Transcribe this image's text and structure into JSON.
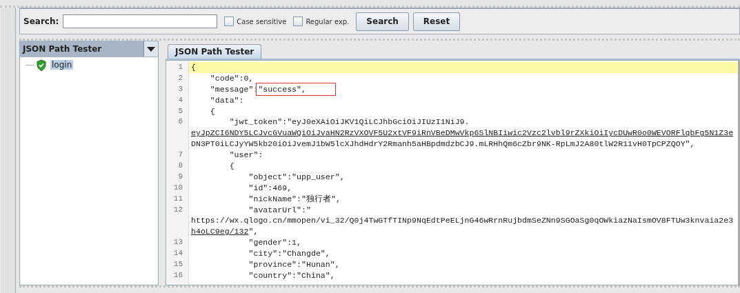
{
  "search_bar": {
    "label": "Search:",
    "options": [
      {
        "label": "Case sensitive",
        "checked": false
      },
      {
        "label": "Regular exp.",
        "checked": false
      }
    ],
    "buttons": [
      "Search",
      "Reset"
    ]
  },
  "sidebar": {
    "title": "JSON Path Tester",
    "items": [
      {
        "label": "login",
        "selected": true
      }
    ]
  },
  "tabs": [
    {
      "label": "JSON Path Tester",
      "selected": true
    }
  ],
  "editor": {
    "lines": [
      {
        "number": "1",
        "current": true,
        "rows": [
          [
            {
              "text": "{"
            }
          ]
        ]
      },
      {
        "number": "2",
        "current": false,
        "rows": [
          [
            {
              "text": "    \"code\":0,"
            }
          ]
        ]
      },
      {
        "number": "3",
        "current": false,
        "rows": [
          [
            {
              "text": "    \"message\":"
            },
            {
              "text": "\"success\",",
              "boxed": true
            }
          ]
        ]
      },
      {
        "number": "4",
        "current": false,
        "rows": [
          [
            {
              "text": "    \"data\":"
            }
          ]
        ]
      },
      {
        "number": "5",
        "current": false,
        "rows": [
          [
            {
              "text": "    {"
            }
          ]
        ]
      },
      {
        "number": "6",
        "current": false,
        "rows": [
          [
            {
              "text": "        \"jwt_token\":\"eyJ0eXAiOiJKV1QiLCJhbGciOiJIUzI1NiJ9."
            }
          ],
          [
            {
              "text": "eyJpZCI6NDY5LCJvcGVuaWQiOiJvaHN2RzVXOVF5U2xtVF9iRnVBeDMwVkp6SlNBIiwic2Vzc2lvbl9rZXkiOiIycDUwR0o0WEVORFlqbFg5N1Z3e",
              "underlined": true
            }
          ],
          [
            {
              "text": "DN3PT0iLCJyYW5kb20iOiJvemJ1bW5lcXJhdHdrY2Rmanh5aHBpdmdzbCJ9.mLRHhQm6cZbr9NK-RpLmJ2A80tlW2R11vH0TpCPZQOY\","
            }
          ]
        ]
      },
      {
        "number": "7",
        "current": false,
        "rows": [
          [
            {
              "text": "        \"user\":"
            }
          ]
        ]
      },
      {
        "number": "8",
        "current": false,
        "rows": [
          [
            {
              "text": "        {"
            }
          ]
        ]
      },
      {
        "number": "9",
        "current": false,
        "rows": [
          [
            {
              "text": "            \"object\":\"upp_user\","
            }
          ]
        ]
      },
      {
        "number": "10",
        "current": false,
        "rows": [
          [
            {
              "text": "            \"id\":469,"
            }
          ]
        ]
      },
      {
        "number": "11",
        "current": false,
        "rows": [
          [
            {
              "text": "            \"nickName\":\"独行者\","
            }
          ]
        ]
      },
      {
        "number": "12",
        "current": false,
        "rows": [
          [
            {
              "text": "            \"avatarUrl\":\""
            }
          ],
          [
            {
              "text": "https://wx.qlogo.cn/mmopen/vi_32/Q0j4TwGTfTINp9NqEdtPeELjnG46wRrnRujbdmSeZNn9SGOaSg0qOWkiazNaIsmOV8FTUw3knvaia2e3"
            }
          ],
          [
            {
              "text": "h4oLC9eg/132",
              "underlined": true
            },
            {
              "text": "\","
            }
          ]
        ]
      },
      {
        "number": "13",
        "current": false,
        "rows": [
          [
            {
              "text": "            \"gender\":1,"
            }
          ]
        ]
      },
      {
        "number": "14",
        "current": false,
        "rows": [
          [
            {
              "text": "            \"city\":\"Changde\","
            }
          ]
        ]
      },
      {
        "number": "15",
        "current": false,
        "rows": [
          [
            {
              "text": "            \"province\":\"Hunan\","
            }
          ]
        ]
      },
      {
        "number": "16",
        "current": false,
        "rows": [
          [
            {
              "text": "            \"country\":\"China\","
            }
          ]
        ]
      }
    ]
  }
}
